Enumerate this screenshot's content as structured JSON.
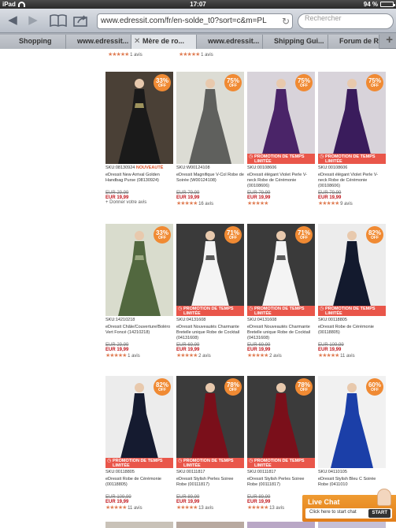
{
  "status": {
    "device": "iPad",
    "time": "17:07",
    "battery": "94 %",
    "battery_level": 0.94
  },
  "toolbar": {
    "back_icon": "back-arrow-icon",
    "forward_icon": "forward-arrow-icon",
    "url": "www.edressit.com/fr/en-solde_t0?sort=c&m=PL",
    "search_placeholder": "Rechercher"
  },
  "tabs": [
    {
      "label": "Shopping"
    },
    {
      "label": "www.edressit..."
    },
    {
      "label": "Mère de ro..."
    },
    {
      "label": "www.edressit..."
    },
    {
      "label": "Shipping Gui..."
    },
    {
      "label": "Forum de Re..."
    }
  ],
  "top_row": [
    {
      "reviews": "1 avis"
    },
    {
      "reviews": "1 avis"
    }
  ],
  "products": [
    {
      "discount": "33%",
      "off": "OFF",
      "sku": "SKU:08130924",
      "new_badge": "NOUVEAUTÉ",
      "name": "eDressit New Arrival Golden Handbag Purse (08130924)",
      "old_price": "EUR 29,99",
      "price": "EUR 19,99",
      "reviews": "+ Donner votre avis",
      "promo": "",
      "colors": [
        "#4a4036",
        "#1a1a1a",
        "#d7c87a"
      ]
    },
    {
      "discount": "75%",
      "off": "OFF",
      "sku": "SKU:W00124108",
      "new_badge": "",
      "name": "eDressit Magnifique V-Col Robe de Soirée (W00124108)",
      "old_price": "EUR 79,99",
      "price": "EUR 19,99",
      "reviews": "16 avis",
      "promo": "",
      "colors": [
        "#dcdcd4",
        "#5f605d",
        "#5f605d"
      ]
    },
    {
      "discount": "75%",
      "off": "OFF",
      "sku": "SKU:00108606",
      "new_badge": "",
      "name": "eDressit élégant Violet Perle V-neck Robe de Cérémonie (00108606)",
      "old_price": "EUR 79,99",
      "price": "EUR 19,99",
      "reviews": "",
      "promo": "PROMOTION DE TEMPS LIMITÉE",
      "colors": [
        "#d8d3da",
        "#4a2468",
        "#4a2468"
      ]
    },
    {
      "discount": "75%",
      "off": "OFF",
      "sku": "SKU:00108606",
      "new_badge": "",
      "name": "eDressit élégant Violet Perle V-neck Robe de Cérémonie (00108606)",
      "old_price": "EUR 79,99",
      "price": "EUR 19,99",
      "reviews": "9 avis",
      "promo": "PROMOTION DE TEMPS LIMITÉE",
      "colors": [
        "#d8d3da",
        "#3a1c5c",
        "#3a1c5c"
      ]
    },
    {
      "discount": "33%",
      "off": "OFF",
      "sku": "SKU:14210218",
      "new_badge": "",
      "name": "eDressit Châle/Couverture/Boléro Vert Foncé (14210218)",
      "old_price": "EUR 29,99",
      "price": "EUR 19,99",
      "reviews": "1 avis",
      "promo": "",
      "colors": [
        "#d9dccd",
        "#52683f",
        "#b7c09a"
      ]
    },
    {
      "discount": "71%",
      "off": "OFF",
      "sku": "SKU:04131608",
      "new_badge": "",
      "name": "eDressit Nouveautés Charmante Bretelle unique Robe de Cocktail (04131608)",
      "old_price": "EUR 69,99",
      "price": "EUR 19,99",
      "reviews": "2 avis",
      "promo": "PROMOTION DE TEMPS LIMITÉE",
      "colors": [
        "#3a3a3a",
        "#f4f4f4",
        "#1a1a1a"
      ]
    },
    {
      "discount": "71%",
      "off": "OFF",
      "sku": "SKU:04131608",
      "new_badge": "",
      "name": "eDressit Nouveautés Charmante Bretelle unique Robe de Cocktail (04131608)",
      "old_price": "EUR 69,99",
      "price": "EUR 19,99",
      "reviews": "2 avis",
      "promo": "PROMOTION DE TEMPS LIMITÉE",
      "colors": [
        "#3a3a3a",
        "#f4f4f4",
        "#1a1a1a"
      ]
    },
    {
      "discount": "82%",
      "off": "OFF",
      "sku": "SKU:00118805",
      "new_badge": "",
      "name": "eDressit Robe de Cérémonie (00118805)",
      "old_price": "EUR 109,99",
      "price": "EUR 19,99",
      "reviews": "11 avis",
      "promo": "PROMOTION DE TEMPS LIMITÉE",
      "colors": [
        "#ececec",
        "#131a2e",
        "#131a2e"
      ]
    },
    {
      "discount": "82%",
      "off": "OFF",
      "sku": "SKU:00118805",
      "new_badge": "",
      "name": "eDressit Robe de Cérémonie (00118805)",
      "old_price": "EUR 109,99",
      "price": "EUR 19,99",
      "reviews": "11 avis",
      "promo": "PROMOTION DE TEMPS LIMITÉE",
      "colors": [
        "#ececec",
        "#151b30",
        "#151b30"
      ]
    },
    {
      "discount": "78%",
      "off": "OFF",
      "sku": "SKU:00111817",
      "new_badge": "",
      "name": "eDressit Stylish Perles Soiree Robe (00111817)",
      "old_price": "EUR 89,99",
      "price": "EUR 19,99",
      "reviews": "13 avis",
      "promo": "PROMOTION DE TEMPS LIMITÉE",
      "colors": [
        "#3b3b3b",
        "#7a0f1a",
        "#7a0f1a"
      ]
    },
    {
      "discount": "78%",
      "off": "OFF",
      "sku": "SKU:00111817",
      "new_badge": "",
      "name": "eDressit Stylish Perles Soiree Robe (00111817)",
      "old_price": "EUR 89,99",
      "price": "EUR 19,99",
      "reviews": "13 avis",
      "promo": "PROMOTION DE TEMPS LIMITÉE",
      "colors": [
        "#3b3b3b",
        "#7a0f1a",
        "#7a0f1a"
      ]
    },
    {
      "discount": "60%",
      "off": "OFF",
      "sku": "SKU:04110105",
      "new_badge": "",
      "name": "eDressit Stylish Bleu C Soirée Robe (0411010",
      "old_price": "",
      "price": "",
      "reviews": "",
      "promo": "",
      "colors": [
        "#f1f1f1",
        "#1b3fa8",
        "#1b3fa8"
      ]
    }
  ],
  "livechat": {
    "title": "Live Chat",
    "text": "Click here to start chat",
    "button": "START"
  },
  "colors": {
    "accent_orange": "#f08a33",
    "price_red": "#c0141b",
    "promo_red": "#e9564a"
  }
}
